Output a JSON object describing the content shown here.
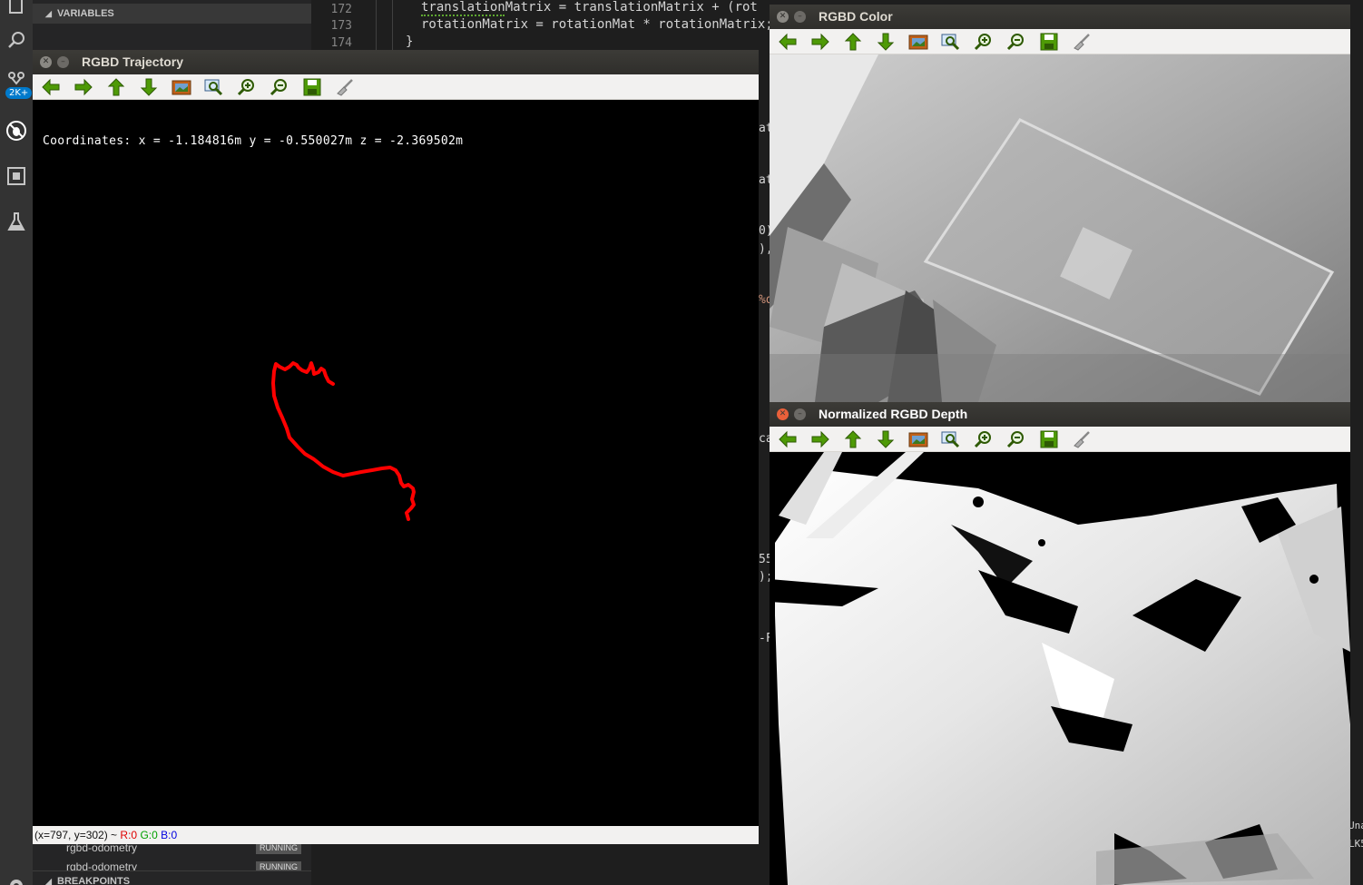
{
  "vscode": {
    "sidebar": {
      "variables_header": "VARIABLES",
      "breakpoints_header": "BREAKPOINTS",
      "processes": [
        {
          "name": "rgbd-odometry",
          "status": "RUNNING"
        },
        {
          "name": "rgbd-odometry",
          "status": "RUNNING"
        }
      ]
    },
    "activity_badge": "2K+",
    "editor": {
      "lines": [
        {
          "number": "172",
          "text": "translationMatrix = translationMatrix + (rot"
        },
        {
          "number": "173",
          "text": "rotationMatrix = rotationMat * rotationMatrix;"
        },
        {
          "number": "174",
          "text": "}"
        }
      ],
      "fragments": [
        "at",
        "at",
        "0)",
        "),",
        "%d",
        "ca",
        "55",
        ");",
        "-F",
        "Una",
        "LK5"
      ]
    }
  },
  "windows": {
    "trajectory": {
      "title": "RGBD Trajectory",
      "coordinates_text": "Coordinates: x = -1.184816m y = -0.550027m z = -2.369502m",
      "status": {
        "position": "(x=797, y=302) ~ ",
        "r": "R:0",
        "g": "G:0",
        "b": "B:0"
      },
      "trajectory_color": "#ff0000"
    },
    "color": {
      "title": "RGBD Color"
    },
    "depth": {
      "title": "Normalized RGBD Depth"
    }
  },
  "toolbar_icons": [
    "arrow-left-icon",
    "arrow-right-icon",
    "arrow-up-icon",
    "arrow-down-icon",
    "image-icon",
    "zoom-fit-icon",
    "zoom-in-icon",
    "zoom-out-icon",
    "save-icon",
    "properties-brush-icon"
  ]
}
